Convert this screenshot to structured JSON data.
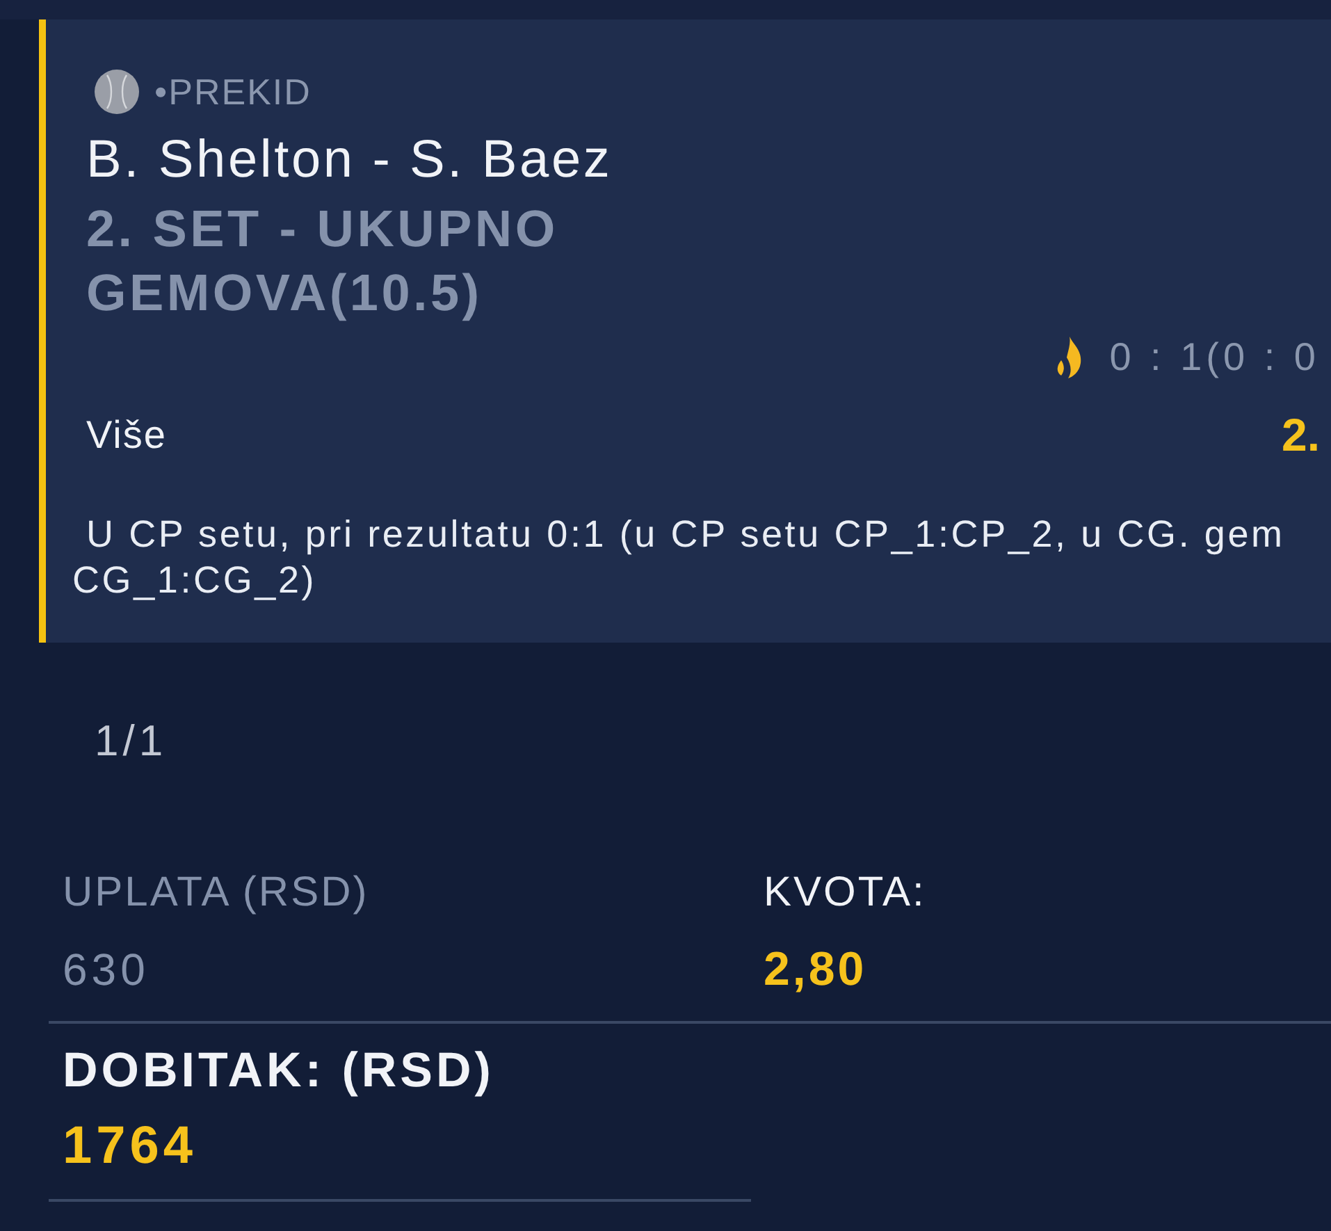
{
  "bet": {
    "status": "•PREKID",
    "match": "B. Shelton - S. Baez",
    "market": "2. SET - UKUPNO GEMOVA(10.5)",
    "score": "0 : 1(0 : 0",
    "selection": "Više",
    "odds": "2.",
    "description": "U CP setu, pri rezultatu 0:1 (u CP setu CP_1:CP_2, u CG. gem\nCG_1:CG_2)"
  },
  "pager": "1/1",
  "summary": [
    {
      "label": "UPLATA (RSD)",
      "value": "630",
      "kind": "stake"
    },
    {
      "label": "KVOTA:",
      "value": "2,80",
      "kind": "odds"
    }
  ],
  "payout": {
    "label": "DOBITAK: (RSD)",
    "value": "1764"
  }
}
